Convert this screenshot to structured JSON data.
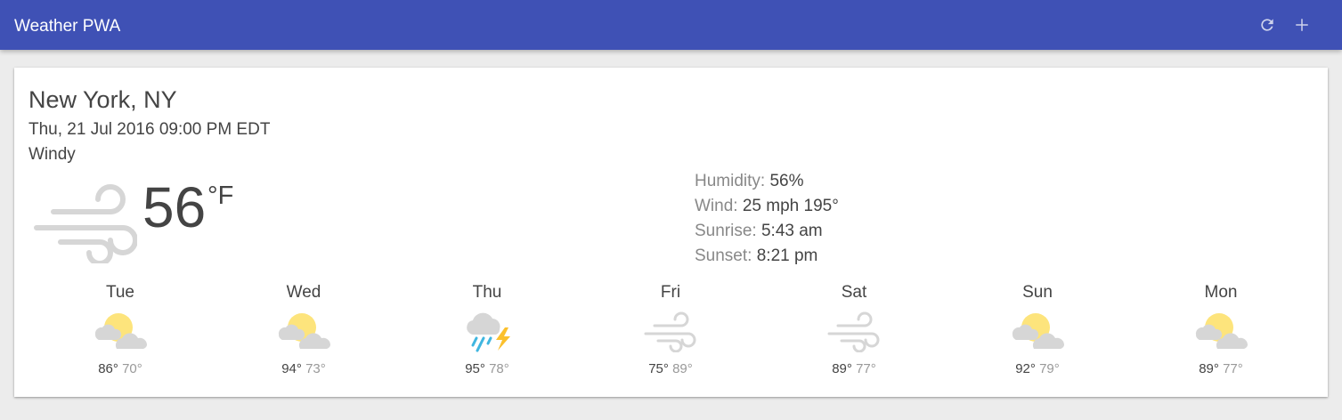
{
  "app": {
    "title": "Weather PWA"
  },
  "toolbar": {
    "refresh_icon": "refresh-icon",
    "add_icon": "add-icon"
  },
  "current": {
    "location": "New York, NY",
    "date": "Thu, 21 Jul 2016 09:00 PM EDT",
    "description": "Windy",
    "icon": "windy-icon",
    "temperature": "56",
    "unit": "°F",
    "humidity_label": "Humidity:",
    "humidity": "56%",
    "wind_label": "Wind:",
    "wind": "25 mph 195°",
    "sunrise_label": "Sunrise:",
    "sunrise": "5:43 am",
    "sunset_label": "Sunset:",
    "sunset": "8:21 pm"
  },
  "forecast": [
    {
      "day": "Tue",
      "icon": "partly-cloudy-icon",
      "high": "86°",
      "low": "70°"
    },
    {
      "day": "Wed",
      "icon": "partly-cloudy-icon",
      "high": "94°",
      "low": "73°"
    },
    {
      "day": "Thu",
      "icon": "thunderstorm-icon",
      "high": "95°",
      "low": "78°"
    },
    {
      "day": "Fri",
      "icon": "windy-icon",
      "high": "75°",
      "low": "89°"
    },
    {
      "day": "Sat",
      "icon": "windy-icon",
      "high": "89°",
      "low": "77°"
    },
    {
      "day": "Sun",
      "icon": "partly-cloudy-icon",
      "high": "92°",
      "low": "79°"
    },
    {
      "day": "Mon",
      "icon": "partly-cloudy-icon",
      "high": "89°",
      "low": "77°"
    }
  ],
  "colors": {
    "header": "#3f51b5",
    "sun": "#fde47c",
    "cloud": "#d6d6d6",
    "rain": "#3fb6e0",
    "bolt": "#fbc02d"
  }
}
